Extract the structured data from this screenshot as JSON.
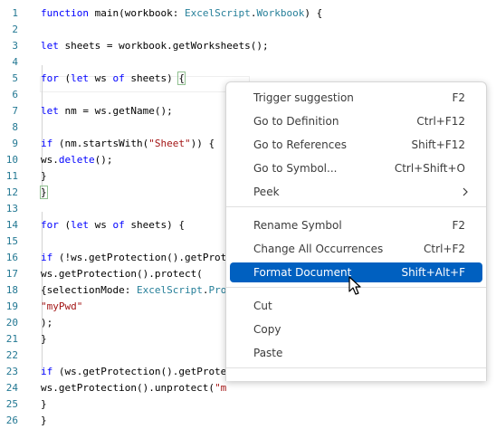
{
  "editor": {
    "line_numbers": [
      "1",
      "2",
      "3",
      "4",
      "5",
      "6",
      "7",
      "8",
      "9",
      "10",
      "11",
      "12",
      "13",
      "14",
      "15",
      "16",
      "17",
      "18",
      "19",
      "20",
      "21",
      "22",
      "23",
      "24",
      "25",
      "26"
    ],
    "lines": [
      [
        {
          "t": "function ",
          "c": "kw"
        },
        {
          "t": "main(workbook: "
        },
        {
          "t": "ExcelScript",
          "c": "ty"
        },
        {
          "t": "."
        },
        {
          "t": "Workbook",
          "c": "ty"
        },
        {
          "t": ") {"
        }
      ],
      [],
      [
        {
          "t": "let ",
          "c": "kw"
        },
        {
          "t": "sheets = workbook.getWorksheets();"
        }
      ],
      [],
      [
        {
          "t": "for ",
          "c": "kw"
        },
        {
          "t": "("
        },
        {
          "t": "let ",
          "c": "kw"
        },
        {
          "t": "ws "
        },
        {
          "t": "of ",
          "c": "kw"
        },
        {
          "t": "sheets) "
        },
        {
          "t": "{",
          "c": "bm"
        }
      ],
      [],
      [
        {
          "t": "let ",
          "c": "kw"
        },
        {
          "t": "nm = ws.getName();"
        }
      ],
      [],
      [
        {
          "t": "if ",
          "c": "kw"
        },
        {
          "t": "(nm.startsWith("
        },
        {
          "t": "\"Sheet\"",
          "c": "st"
        },
        {
          "t": ")) {"
        }
      ],
      [
        {
          "t": "ws."
        },
        {
          "t": "delete",
          "c": "kw"
        },
        {
          "t": "();"
        }
      ],
      [
        {
          "t": "}"
        }
      ],
      [
        {
          "t": "}",
          "c": "bm"
        }
      ],
      [],
      [
        {
          "t": "for ",
          "c": "kw"
        },
        {
          "t": "("
        },
        {
          "t": "let ",
          "c": "kw"
        },
        {
          "t": "ws "
        },
        {
          "t": "of ",
          "c": "kw"
        },
        {
          "t": "sheets) {"
        }
      ],
      [],
      [
        {
          "t": "if ",
          "c": "kw"
        },
        {
          "t": "(!ws.getProtection().getProt"
        }
      ],
      [
        {
          "t": "ws.getProtection().protect("
        }
      ],
      [
        {
          "t": "{selectionMode: "
        },
        {
          "t": "ExcelScript",
          "c": "ty"
        },
        {
          "t": "."
        },
        {
          "t": "Pro",
          "c": "ty"
        }
      ],
      [
        {
          "t": "\"myPwd\"",
          "c": "st"
        }
      ],
      [
        {
          "t": ");"
        }
      ],
      [
        {
          "t": "}"
        }
      ],
      [],
      [
        {
          "t": "if ",
          "c": "kw"
        },
        {
          "t": "(ws.getProtection().getProte"
        }
      ],
      [
        {
          "t": "ws.getProtection().unprotect("
        },
        {
          "t": "\"m",
          "c": "st"
        }
      ],
      [
        {
          "t": "}"
        }
      ],
      [
        {
          "t": "}"
        }
      ]
    ]
  },
  "context_menu": {
    "groups": [
      [
        {
          "label": "Trigger suggestion",
          "shortcut": "F2"
        },
        {
          "label": "Go to Definition",
          "shortcut": "Ctrl+F12"
        },
        {
          "label": "Go to References",
          "shortcut": "Shift+F12"
        },
        {
          "label": "Go to Symbol...",
          "shortcut": "Ctrl+Shift+O"
        },
        {
          "label": "Peek",
          "shortcut": "",
          "submenu": true
        }
      ],
      [
        {
          "label": "Rename Symbol",
          "shortcut": "F2"
        },
        {
          "label": "Change All Occurrences",
          "shortcut": "Ctrl+F2"
        },
        {
          "label": "Format Document",
          "shortcut": "Shift+Alt+F",
          "selected": true
        }
      ],
      [
        {
          "label": "Cut",
          "shortcut": ""
        },
        {
          "label": "Copy",
          "shortcut": ""
        },
        {
          "label": "Paste",
          "shortcut": ""
        }
      ],
      []
    ]
  },
  "colors": {
    "keyword": "#0000ff",
    "type": "#267f99",
    "string": "#a31515",
    "line_number": "#237893",
    "menu_selection": "#0060c0"
  }
}
